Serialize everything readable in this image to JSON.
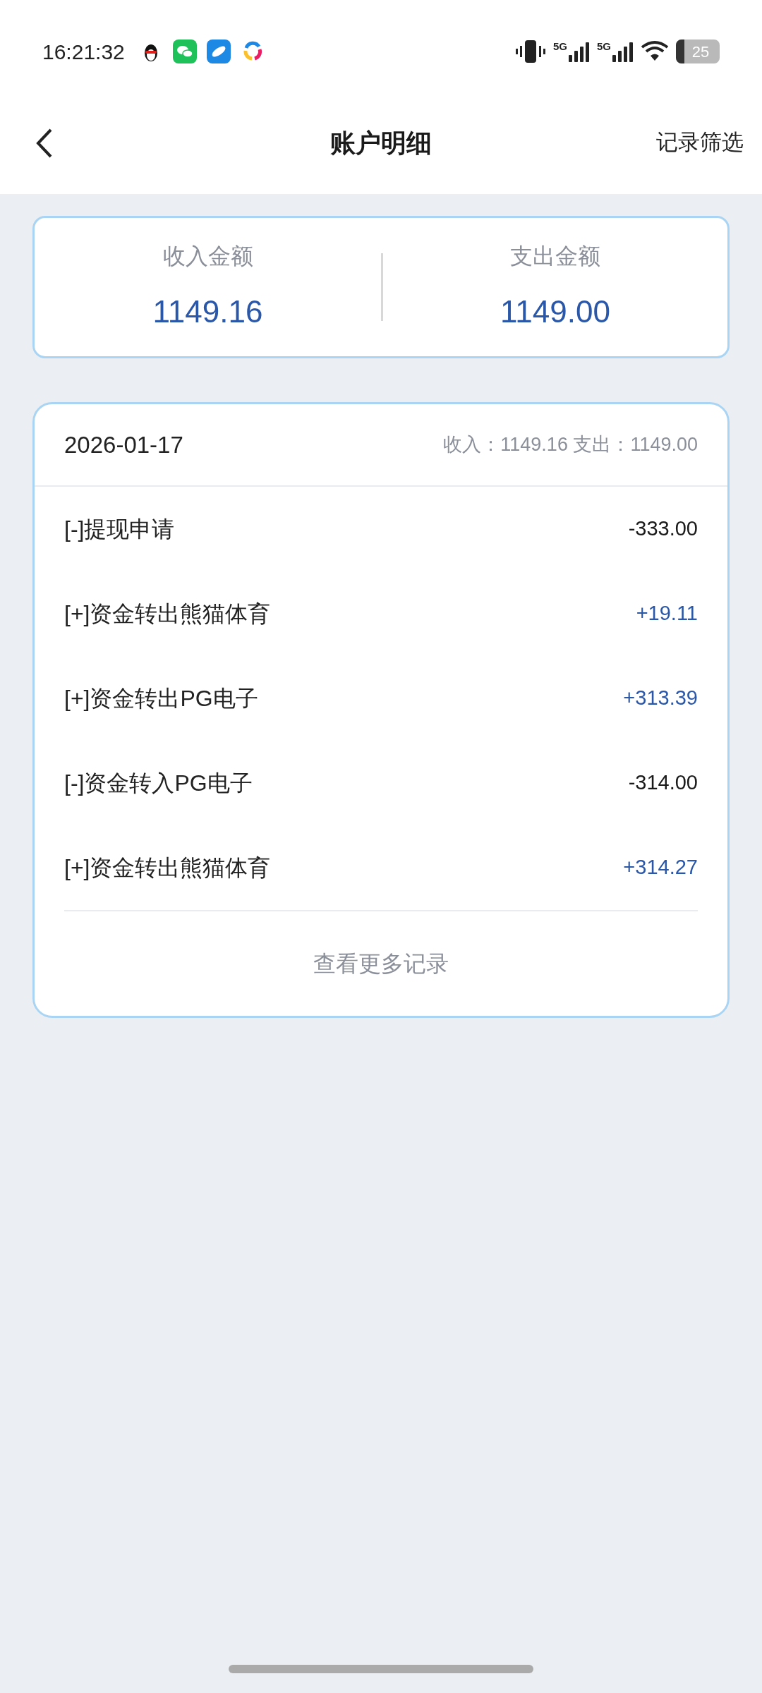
{
  "status_bar": {
    "time": "16:21:32",
    "network_1": "5G",
    "network_2": "5G",
    "battery": "25"
  },
  "header": {
    "title": "账户明细",
    "action": "记录筛选"
  },
  "summary": [
    {
      "label": "收入金额",
      "amount": "1149.16"
    },
    {
      "label": "支出金额",
      "amount": "1149.00"
    }
  ],
  "day": {
    "date": "2026-01-17",
    "totals": "收入：1149.16 支出：1149.00",
    "records": [
      {
        "title": "[-]提现申请",
        "amount": "-333.00",
        "kind": "expense"
      },
      {
        "title": "[+]资金转出熊猫体育",
        "amount": "+19.11",
        "kind": "income"
      },
      {
        "title": "[+]资金转出PG电子",
        "amount": "+313.39",
        "kind": "income"
      },
      {
        "title": "[-]资金转入PG电子",
        "amount": "-314.00",
        "kind": "expense"
      },
      {
        "title": "[+]资金转出熊猫体育",
        "amount": "+314.27",
        "kind": "income"
      }
    ],
    "more": "查看更多记录"
  }
}
